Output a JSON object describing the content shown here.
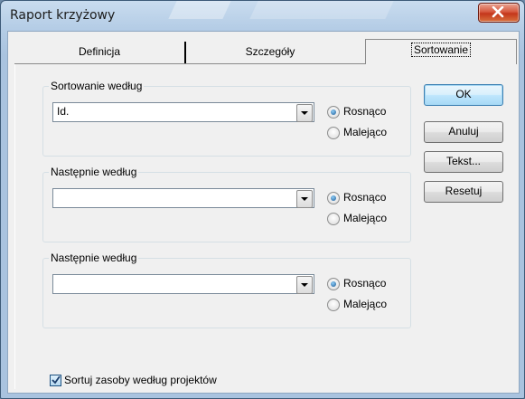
{
  "window": {
    "title": "Raport krzyżowy",
    "close_glyph": "×"
  },
  "tabs": [
    {
      "label": "Definicja"
    },
    {
      "label": "Szczegóły"
    },
    {
      "label": "Sortowanie",
      "selected": true
    }
  ],
  "groups": [
    {
      "title": "Sortowanie według",
      "combo_value": "Id.",
      "asc_label": "Rosnąco",
      "desc_label": "Malejąco",
      "selected": "asc"
    },
    {
      "title": "Następnie według",
      "combo_value": "",
      "asc_label": "Rosnąco",
      "desc_label": "Malejąco",
      "selected": "asc"
    },
    {
      "title": "Następnie według",
      "combo_value": "",
      "asc_label": "Rosnąco",
      "desc_label": "Malejąco",
      "selected": "asc"
    }
  ],
  "buttons": {
    "ok": "OK",
    "cancel": "Anuluj",
    "text": "Tekst...",
    "reset": "Resetuj"
  },
  "checkbox": {
    "label": "Sortuj zasoby według projektów",
    "checked": true
  },
  "colors": {
    "titlebar": "#b5cde6",
    "close": "#c4361b",
    "dialog_bg": "#f0f0f0",
    "default_button": "#3c7fb1"
  }
}
